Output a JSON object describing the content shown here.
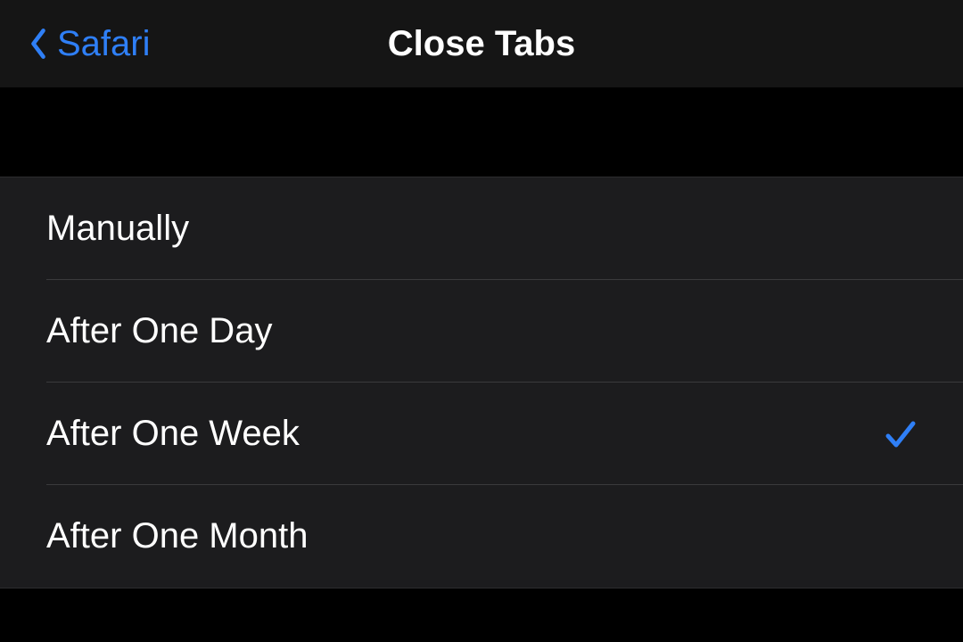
{
  "nav": {
    "back_label": "Safari",
    "title": "Close Tabs"
  },
  "options": [
    {
      "label": "Manually",
      "selected": false
    },
    {
      "label": "After One Day",
      "selected": false
    },
    {
      "label": "After One Week",
      "selected": true
    },
    {
      "label": "After One Month",
      "selected": false
    }
  ],
  "colors": {
    "accent": "#2f7ff6",
    "background": "#000000",
    "cell_background": "#1c1c1e",
    "text": "#ffffff"
  }
}
